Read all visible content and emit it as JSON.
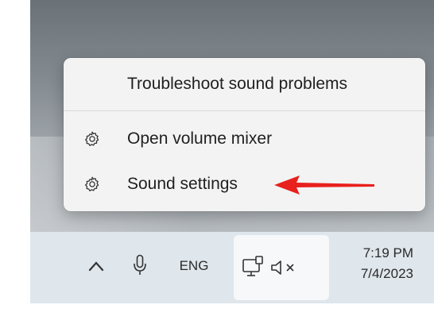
{
  "context_menu": {
    "items": [
      {
        "label": "Troubleshoot sound problems",
        "icon": null
      },
      {
        "label": "Open volume mixer",
        "icon": "gear-icon"
      },
      {
        "label": "Sound settings",
        "icon": "gear-icon"
      }
    ],
    "annotation": {
      "type": "arrow",
      "color": "#e8201e",
      "points_to": "Sound settings"
    }
  },
  "taskbar": {
    "icons": [
      "chevron-up-icon",
      "microphone-icon",
      "network-icon",
      "speaker-muted-icon"
    ],
    "language": "ENG",
    "time": "7:19 PM",
    "date": "7/4/2023"
  },
  "colors": {
    "menu_bg": "#f3f3f3",
    "taskbar_bg": "#dfe6ec",
    "arrow": "#e8201e"
  }
}
